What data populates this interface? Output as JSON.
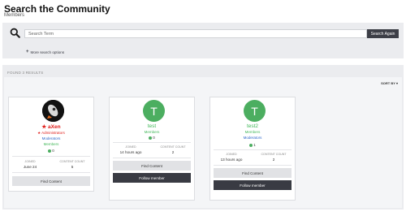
{
  "header": {
    "title": "Search the Community",
    "subtitle": "Members"
  },
  "search": {
    "placeholder": "Search Term",
    "button_label": "Search Again",
    "more_options": "More search options"
  },
  "results": {
    "found_label": "FOUND 3 RESULTS",
    "sort_label": "SORT BY"
  },
  "members": [
    {
      "name": "aXen",
      "name_color": "#e0201c",
      "groups": [
        "Administrators",
        "Moderators",
        "Members"
      ],
      "count": "0",
      "joined_label": "JOINED",
      "joined": "June 24",
      "content_label": "CONTENT COUNT",
      "content_count": "5",
      "find_content": "Find Content"
    },
    {
      "name": "test",
      "avatar_letter": "T",
      "name_color": "#43b85a",
      "groups": [
        "Members"
      ],
      "count": "0",
      "joined_label": "JOINED",
      "joined": "14 hours ago",
      "content_label": "CONTENT COUNT",
      "content_count": "2",
      "find_content": "Find Content",
      "follow": "Follow member"
    },
    {
      "name": "test2",
      "avatar_letter": "T",
      "name_color": "#43b85a",
      "groups": [
        "Members",
        "Moderators"
      ],
      "count": "1",
      "joined_label": "JOINED",
      "joined": "13 hours ago",
      "content_label": "CONTENT COUNT",
      "content_count": "2",
      "find_content": "Find Content",
      "follow": "Follow member"
    }
  ],
  "colors": {
    "accent_dark": "#393b43",
    "admin_red": "#e0201c",
    "member_green": "#43b85a",
    "moderator_blue": "#2c66c9",
    "panel_bg": "#ebecef"
  }
}
